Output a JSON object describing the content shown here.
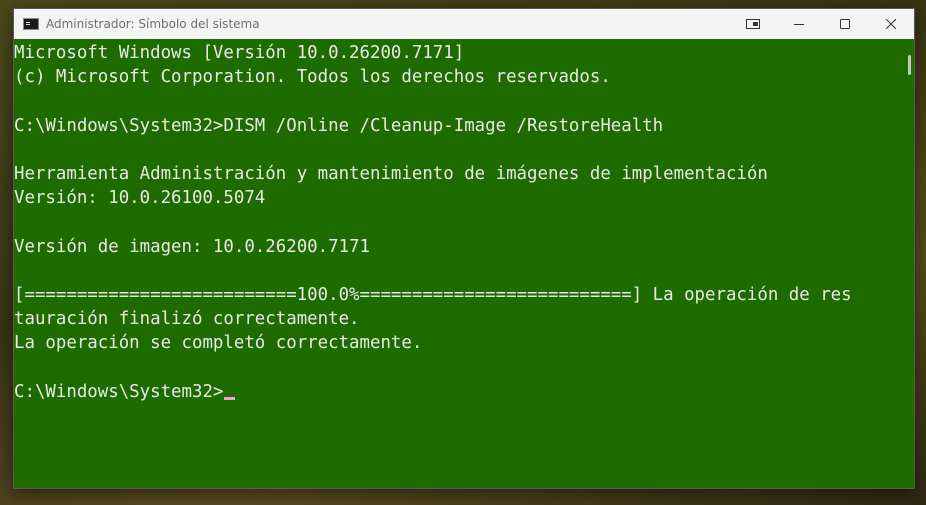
{
  "window": {
    "title": "Administrador: Símbolo del sistema"
  },
  "console": {
    "lines": [
      "Microsoft Windows [Versión 10.0.26200.7171]",
      "(c) Microsoft Corporation. Todos los derechos reservados.",
      "",
      "C:\\Windows\\System32>DISM /Online /Cleanup-Image /RestoreHealth",
      "",
      "Herramienta Administración y mantenimiento de imágenes de implementación",
      "Versión: 10.0.26100.5074",
      "",
      "Versión de imagen: 10.0.26200.7171",
      "",
      "[==========================100.0%==========================] La operación de res",
      "tauración finalizó correctamente.",
      "La operación se completó correctamente.",
      "",
      "C:\\Windows\\System32>"
    ]
  },
  "colors": {
    "console_background": "#1e6b00",
    "console_text": "#e8e8e8",
    "cursor": "#ff9bd3",
    "titlebar": "#f3f3f3"
  }
}
